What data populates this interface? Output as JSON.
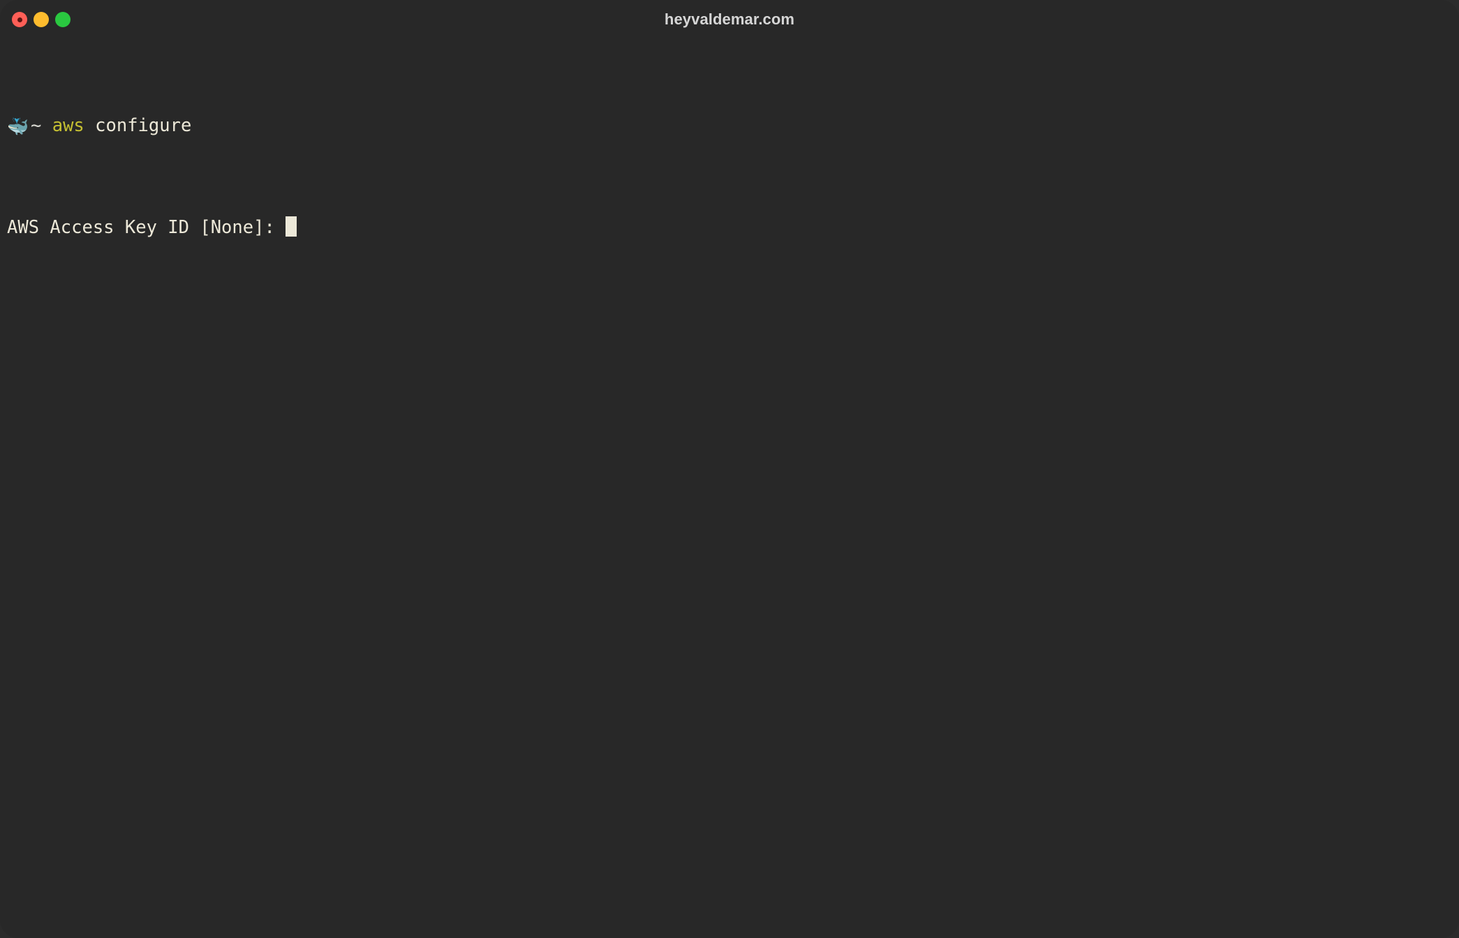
{
  "window": {
    "title": "heyvaldemar.com",
    "background_color": "#282828",
    "traffic_lights": [
      {
        "name": "close",
        "label": "Close",
        "color": "#ff5f57"
      },
      {
        "name": "minimize",
        "label": "Minimize",
        "color": "#febc2e"
      },
      {
        "name": "maximize",
        "label": "Maximize",
        "color": "#2ac840"
      }
    ]
  },
  "terminal": {
    "prompt": {
      "icon": "whale-icon",
      "icon_glyph": "🐳",
      "path": "~",
      "command_name": "aws",
      "command_args": " configure",
      "full_command": "aws configure",
      "prompt_color": "#d9d9d2",
      "command_color": "#c5c032",
      "text_color": "#ece8d8"
    },
    "output_lines": [
      "AWS Access Key ID [None]: "
    ],
    "cursor": {
      "visible": true,
      "style": "block",
      "color": "#ece8d8"
    }
  }
}
